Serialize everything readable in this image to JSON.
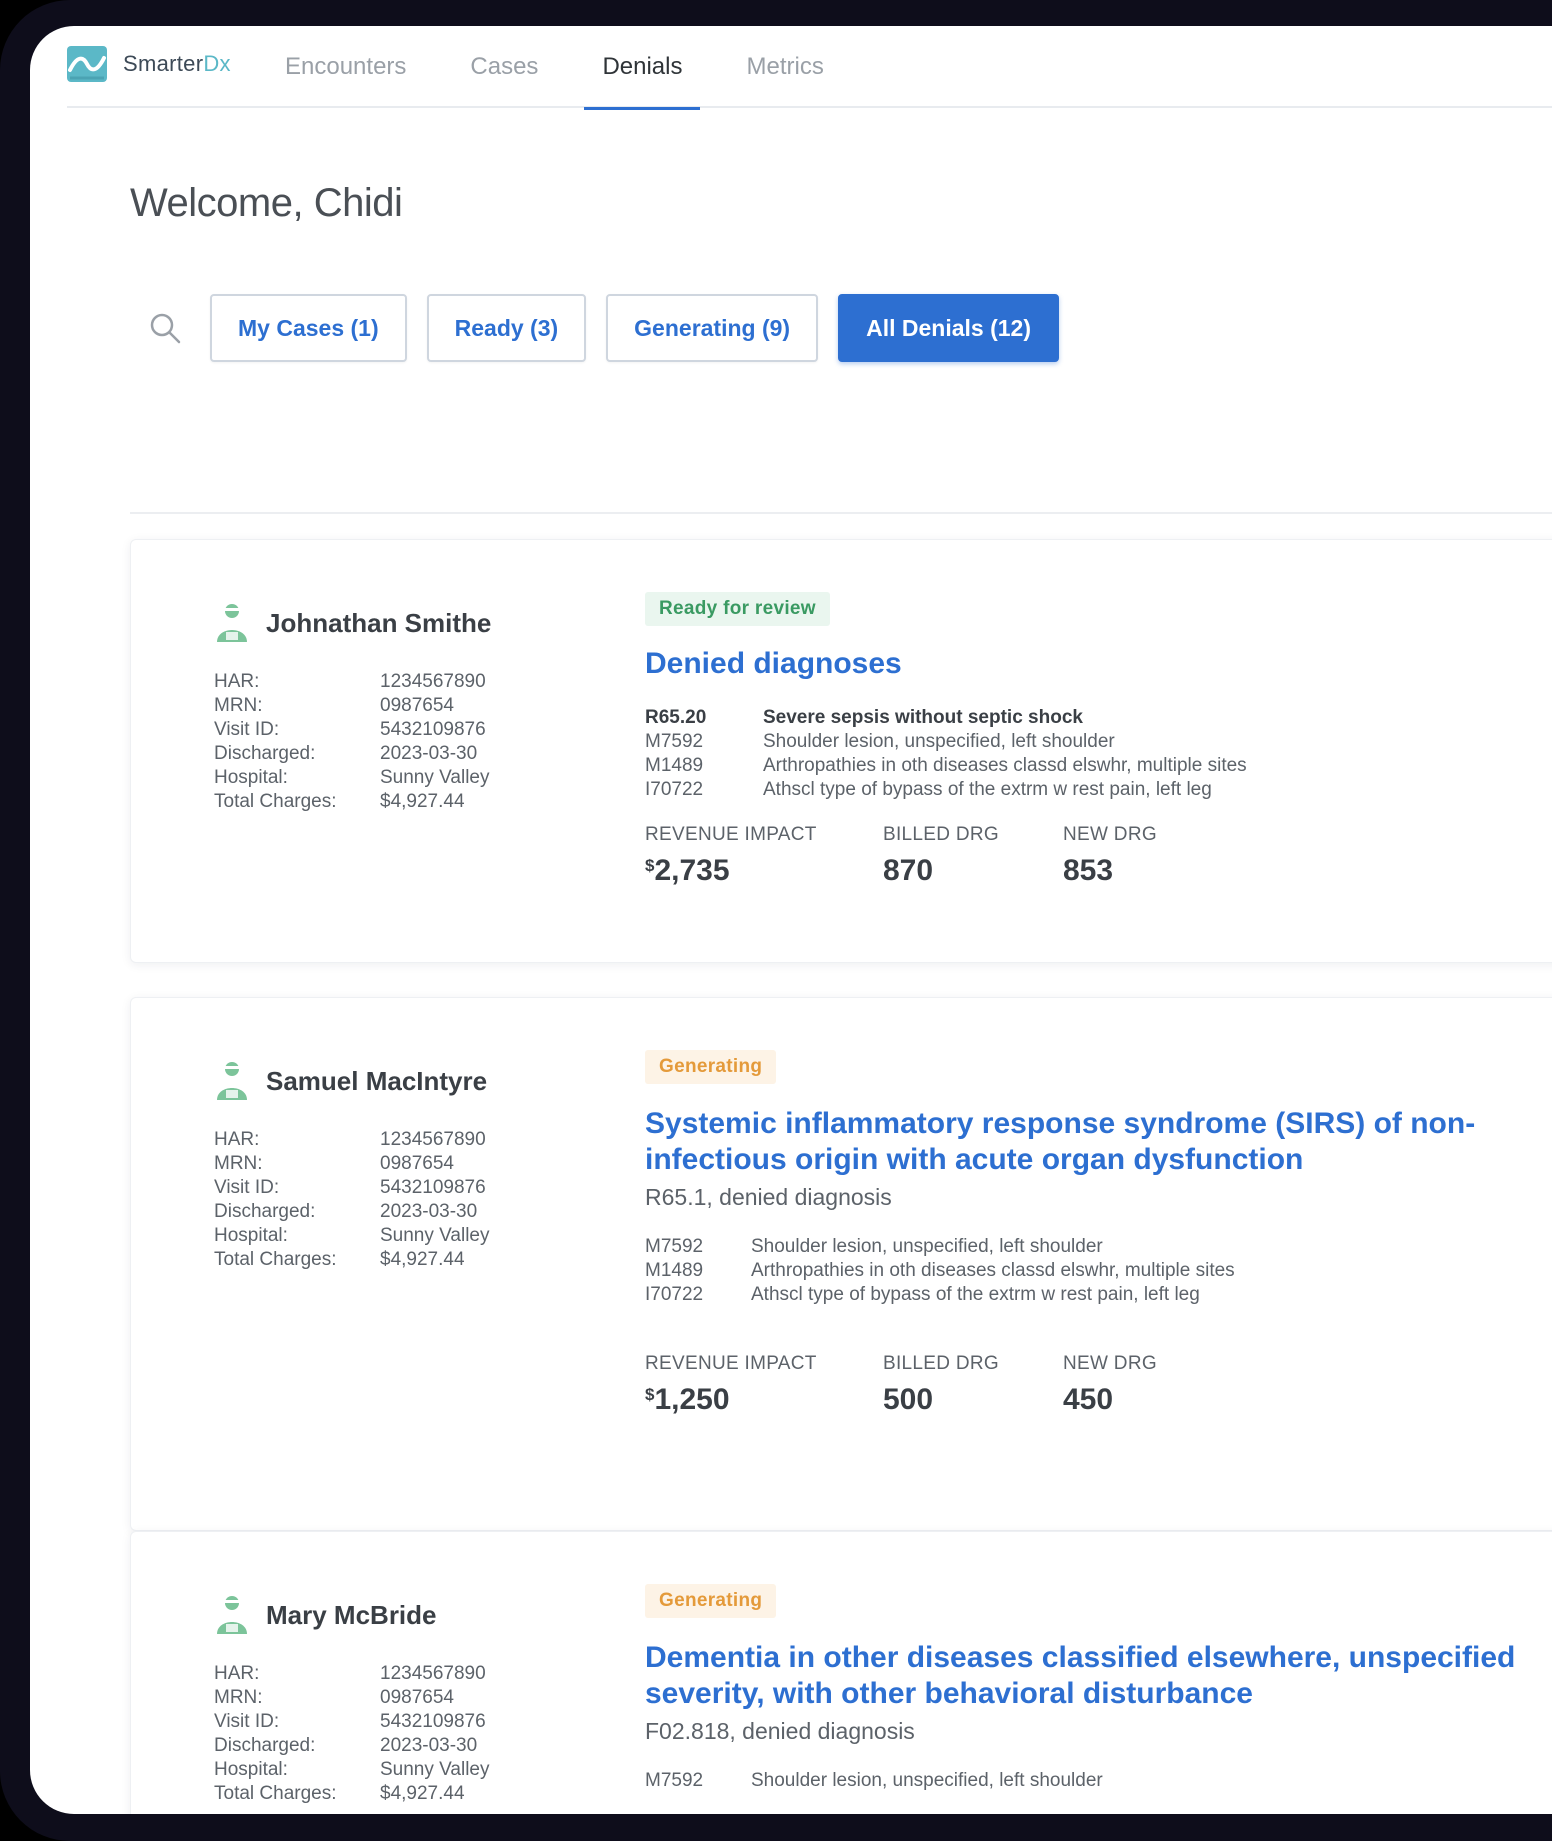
{
  "app": {
    "logo_main": "Smarter",
    "logo_accent": "Dx",
    "brand_color": "#5bb8c7",
    "accent_color": "#2d6fd1"
  },
  "nav": {
    "items": [
      "Encounters",
      "Cases",
      "Denials",
      "Metrics"
    ],
    "active": "Denials"
  },
  "welcome": "Welcome, Chidi",
  "filters": {
    "my_cases": "My Cases (1)",
    "ready": "Ready (3)",
    "generating": "Generating (9)",
    "all_denials": "All Denials (12)",
    "active": "All Denials (12)"
  },
  "meta_labels": {
    "har": "HAR:",
    "mrn": "MRN:",
    "visit_id": "Visit ID:",
    "discharged": "Discharged:",
    "hospital": "Hospital:",
    "total_charges": "Total Charges:"
  },
  "metric_labels": {
    "revenue_impact": "REVENUE IMPACT",
    "billed_drg": "BILLED DRG",
    "new_drg": "NEW DRG"
  },
  "cases": [
    {
      "name": "Johnathan Smithe",
      "har": "1234567890",
      "mrn": "0987654",
      "visit_id": "5432109876",
      "discharged": "2023-03-30",
      "hospital": "Sunny Valley",
      "total_charges": "$4,927.44",
      "status": "Ready for review",
      "title": "Denied diagnoses",
      "codes": [
        {
          "code": "R65.20",
          "desc": "Severe sepsis without septic shock"
        },
        {
          "code": "M7592",
          "desc": "Shoulder lesion, unspecified, left shoulder"
        },
        {
          "code": "M1489",
          "desc": "Arthropathies in oth diseases classd elswhr, multiple sites"
        },
        {
          "code": "I70722",
          "desc": "Athscl type of bypass of the extrm w rest pain, left leg"
        }
      ],
      "currency": "$",
      "revenue_impact": "2,735",
      "billed_drg": "870",
      "new_drg": "853"
    },
    {
      "name": "Samuel MacIntyre",
      "har": "1234567890",
      "mrn": "0987654",
      "visit_id": "5432109876",
      "discharged": "2023-03-30",
      "hospital": "Sunny Valley",
      "total_charges": "$4,927.44",
      "status": "Generating",
      "title": "Systemic inflammatory response syndrome (SIRS) of non-infectious origin with acute organ dysfunction",
      "subtitle": "R65.1, denied diagnosis",
      "codes": [
        {
          "code": "M7592",
          "desc": "Shoulder lesion, unspecified, left shoulder"
        },
        {
          "code": "M1489",
          "desc": "Arthropathies in oth diseases classd elswhr, multiple sites"
        },
        {
          "code": "I70722",
          "desc": "Athscl type of bypass of the extrm w rest pain, left leg"
        }
      ],
      "currency": "$",
      "revenue_impact": "1,250",
      "billed_drg": "500",
      "new_drg": "450"
    },
    {
      "name": "Mary McBride",
      "har": "1234567890",
      "mrn": "0987654",
      "visit_id": "5432109876",
      "discharged": "2023-03-30",
      "hospital": "Sunny Valley",
      "total_charges": "$4,927.44",
      "status": "Generating",
      "title": "Dementia in other diseases classified elsewhere, unspecified severity, with other behavioral disturbance",
      "subtitle": "F02.818, denied diagnosis",
      "codes": [
        {
          "code": "M7592",
          "desc": "Shoulder lesion, unspecified, left shoulder"
        }
      ]
    }
  ]
}
